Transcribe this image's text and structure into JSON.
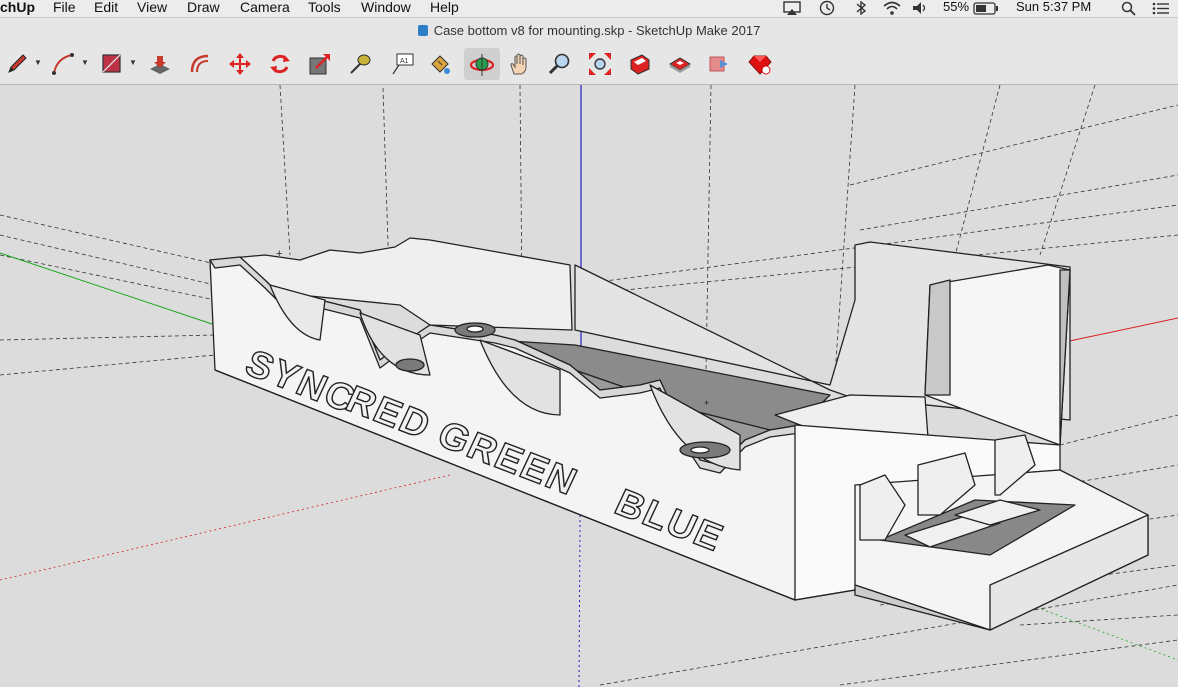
{
  "menubar": {
    "app_name": "chUp",
    "items": [
      "File",
      "Edit",
      "View",
      "Draw",
      "Camera",
      "Tools",
      "Window",
      "Help"
    ],
    "battery": "55%",
    "clock": "Sun 5:37 PM"
  },
  "window": {
    "title": "Case bottom v8 for mounting.skp - SketchUp Make 2017"
  },
  "toolbar": {
    "tools": [
      {
        "name": "pencil-tool",
        "icon": "pencil-icon"
      },
      {
        "name": "arc-tool",
        "icon": "arc-icon"
      },
      {
        "name": "rectangle-tool",
        "icon": "rectangle-icon"
      },
      {
        "name": "push-pull-tool",
        "icon": "push-pull-icon"
      },
      {
        "name": "offset-tool",
        "icon": "offset-icon"
      },
      {
        "name": "move-tool",
        "icon": "move-icon"
      },
      {
        "name": "rotate-tool",
        "icon": "rotate-icon"
      },
      {
        "name": "scale-tool",
        "icon": "scale-icon"
      },
      {
        "name": "tape-measure-tool",
        "icon": "tape-icon"
      },
      {
        "name": "text-tool",
        "icon": "text-icon"
      },
      {
        "name": "paint-bucket-tool",
        "icon": "paint-icon"
      },
      {
        "name": "orbit-tool",
        "icon": "orbit-icon",
        "active": true
      },
      {
        "name": "pan-tool",
        "icon": "hand-icon"
      },
      {
        "name": "zoom-tool",
        "icon": "magnifier-icon"
      },
      {
        "name": "zoom-extents-tool",
        "icon": "zoom-extents-icon"
      },
      {
        "name": "warehouse-tool",
        "icon": "warehouse-icon"
      },
      {
        "name": "share-model-tool",
        "icon": "share-model-icon"
      },
      {
        "name": "extension-warehouse-tool",
        "icon": "extension-icon"
      },
      {
        "name": "ruby-tool",
        "icon": "ruby-icon"
      }
    ],
    "text_tool_glyph": "A1"
  },
  "model": {
    "labels": [
      "SYNC",
      "RED",
      "GREEN",
      "BLUE"
    ]
  },
  "colors": {
    "menubar_bg": "#ececec",
    "toolbar_bg": "#e6e6e6",
    "viewport_bg": "#dcdcdc",
    "model_face": "#f4f4f4",
    "model_shadow": "#9a9a9a",
    "axis_red": "#d62020",
    "axis_green": "#1aa81a",
    "axis_blue": "#2020c8",
    "active_tool_bg": "#cfcfcf"
  }
}
